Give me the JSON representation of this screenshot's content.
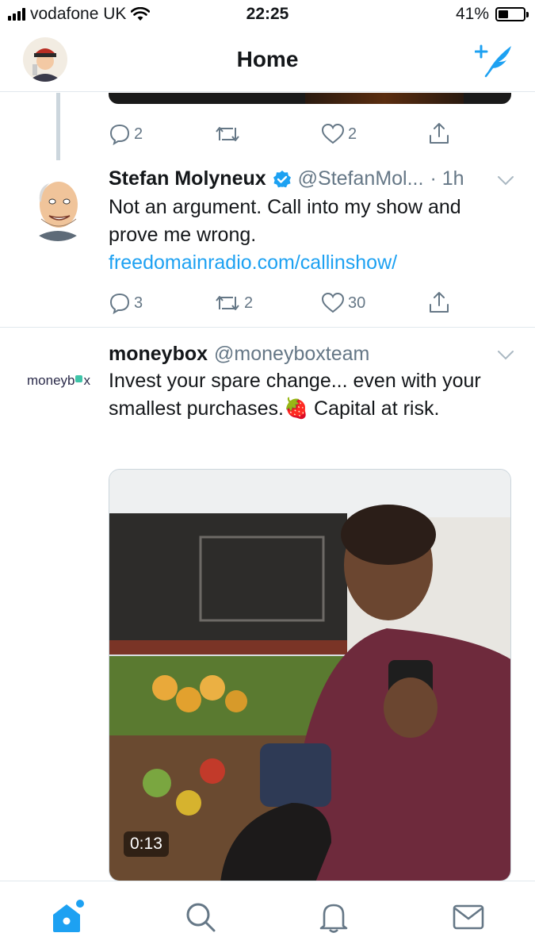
{
  "status_bar": {
    "carrier": "vodafone UK",
    "time": "22:25",
    "battery": "41%",
    "battery_level": 0.41
  },
  "header": {
    "title": "Home"
  },
  "previous_tweet": {
    "replies": "2",
    "retweets": "",
    "likes": "2"
  },
  "tweets": [
    {
      "name": "Stefan Molyneux",
      "handle": "@StefanMol...",
      "time": "· 1h",
      "text_before_link": "Not an argument. Call into my show and prove me wrong. ",
      "link": "freedomainradio.com/callinshow/",
      "replies": "3",
      "retweets": "2",
      "likes": "30",
      "verified": true
    },
    {
      "name": "moneybox",
      "handle": "@moneyboxteam",
      "avatar_text": "moneyb",
      "avatar_text_end": "x",
      "text_before_emoji": "Invest your spare change... even with your smallest purchases.",
      "emoji": "🍓",
      "text_after_emoji": " Capital at risk.",
      "video_duration": "0:13"
    }
  ],
  "colors": {
    "accent": "#1da1f2",
    "muted": "#657786",
    "border": "#e1e8ed"
  },
  "tabs": [
    "home-icon",
    "search-icon",
    "notifications-icon",
    "messages-icon"
  ]
}
